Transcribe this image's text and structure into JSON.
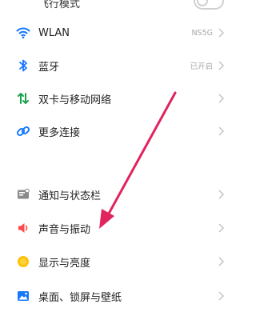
{
  "settings": {
    "top_partial": {
      "label": "飞行模式"
    },
    "wlan": {
      "label": "WLAN",
      "value": "NS5G"
    },
    "bluetooth": {
      "label": "蓝牙",
      "value": "已开启"
    },
    "sim": {
      "label": "双卡与移动网络"
    },
    "more": {
      "label": "更多连接"
    },
    "notify": {
      "label": "通知与状态栏"
    },
    "sound": {
      "label": "声音与振动"
    },
    "display": {
      "label": "显示与亮度"
    },
    "wallpaper": {
      "label": "桌面、锁屏与壁纸"
    }
  },
  "colors": {
    "wlan_icon": "#1677ff",
    "bluetooth_icon": "#1677ff",
    "sim_icon": "#1aa34a",
    "more_icon": "#1677ff",
    "notify_icon": "#7a7a7a",
    "sound_icon": "#ff4a4a",
    "display_icon": "#ffc107",
    "wallpaper_icon": "#1677ff",
    "annotation_arrow": "#e0245e"
  },
  "icons": {
    "wlan": "wifi-icon",
    "bluetooth": "bluetooth-icon",
    "sim": "dual-sim-network-icon",
    "more": "link-icon",
    "notify": "notification-icon",
    "sound": "speaker-icon",
    "display": "brightness-icon",
    "wallpaper": "wallpaper-icon"
  }
}
